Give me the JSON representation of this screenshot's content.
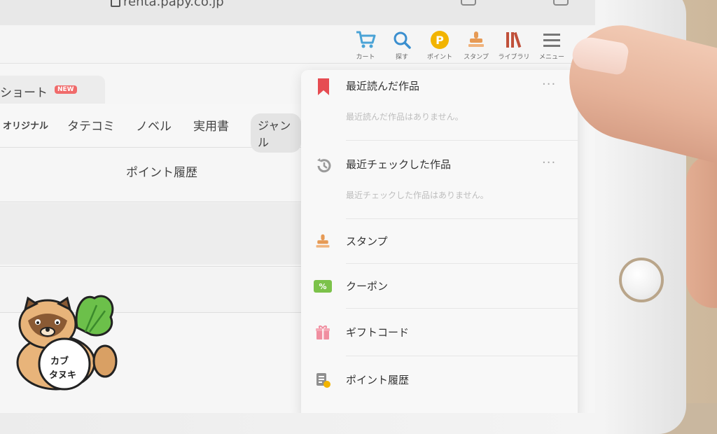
{
  "browser": {
    "url": "renta.papy.co.jp"
  },
  "toolbar": {
    "items": [
      {
        "label": "カート",
        "icon": "cart-icon"
      },
      {
        "label": "探す",
        "icon": "search-icon"
      },
      {
        "label": "ポイント",
        "icon": "point-icon"
      },
      {
        "label": "スタンプ",
        "icon": "stamp-icon"
      },
      {
        "label": "ライブラリ",
        "icon": "library-icon"
      },
      {
        "label": "メニュー",
        "icon": "hamburger-icon"
      }
    ],
    "point_glyph": "P"
  },
  "page": {
    "tab_label": "ショート",
    "new_badge": "NEW",
    "nav": [
      "オリジナル",
      "タテコミ",
      "ノベル",
      "実用書",
      "ジャンル"
    ],
    "heading": "ポイント履歴"
  },
  "menu": {
    "recent_read": {
      "title": "最近読んだ作品",
      "empty": "最近読んだ作品はありません。",
      "more": "···"
    },
    "recent_checked": {
      "title": "最近チェックした作品",
      "empty": "最近チェックした作品はありません。",
      "more": "···"
    },
    "items": [
      {
        "label": "スタンプ",
        "icon": "stamp-icon"
      },
      {
        "label": "クーポン",
        "icon": "coupon-icon"
      },
      {
        "label": "ギフトコード",
        "icon": "gift-icon"
      },
      {
        "label": "ポイント履歴",
        "icon": "point-history-icon"
      }
    ],
    "coupon_glyph": "%"
  },
  "mascot": {
    "caption_top": "カブ",
    "caption_bottom": "タヌキ"
  },
  "colors": {
    "cart": "#4aa3d6",
    "search": "#3b8fcf",
    "point": "#f2b400",
    "stamp": "#e69a55",
    "library": "#c0503a",
    "bookmark": "#e64c52",
    "coupon": "#7cc24a",
    "gift": "#f08ea0"
  }
}
